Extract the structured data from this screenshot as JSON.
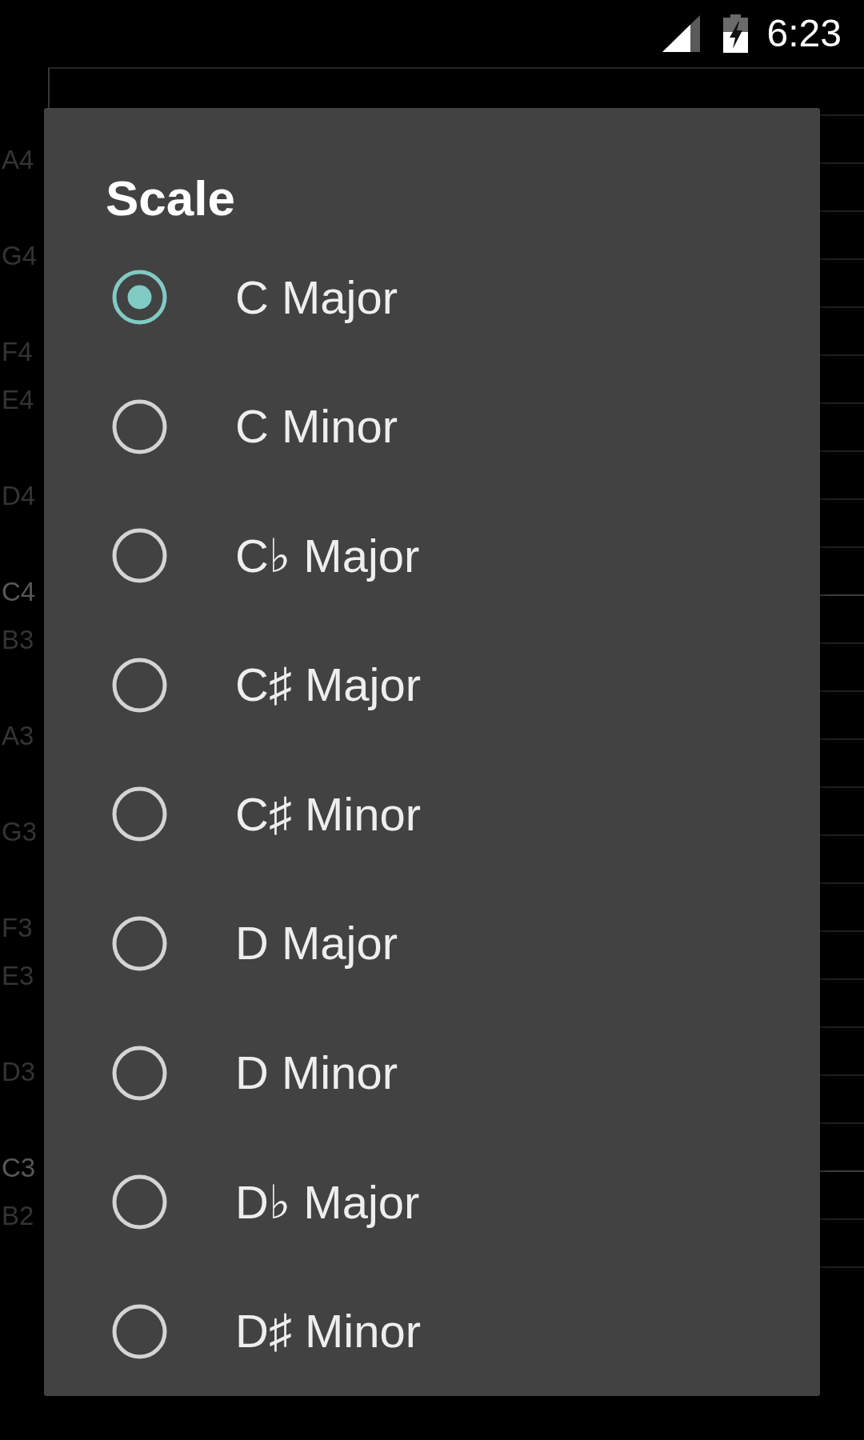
{
  "status_bar": {
    "time": "6:23"
  },
  "piano_roll": {
    "rows": [
      {
        "kind": "sharp"
      },
      {
        "kind": "natural",
        "label": "A4"
      },
      {
        "kind": "sharp"
      },
      {
        "kind": "natural",
        "label": "G4"
      },
      {
        "kind": "sharp"
      },
      {
        "kind": "natural",
        "label": "F4"
      },
      {
        "kind": "natural",
        "label": "E4"
      },
      {
        "kind": "sharp"
      },
      {
        "kind": "natural",
        "label": "D4"
      },
      {
        "kind": "sharp"
      },
      {
        "kind": "octave",
        "label": "C4"
      },
      {
        "kind": "natural",
        "label": "B3"
      },
      {
        "kind": "sharp"
      },
      {
        "kind": "natural",
        "label": "A3"
      },
      {
        "kind": "sharp"
      },
      {
        "kind": "natural",
        "label": "G3"
      },
      {
        "kind": "sharp"
      },
      {
        "kind": "natural",
        "label": "F3"
      },
      {
        "kind": "natural",
        "label": "E3"
      },
      {
        "kind": "sharp"
      },
      {
        "kind": "natural",
        "label": "D3"
      },
      {
        "kind": "sharp"
      },
      {
        "kind": "octave",
        "label": "C3"
      },
      {
        "kind": "natural",
        "label": "B2"
      },
      {
        "kind": "sharp"
      }
    ]
  },
  "dialog": {
    "title": "Scale",
    "options": [
      {
        "label": "C Major",
        "selected": true
      },
      {
        "label": "C Minor",
        "selected": false
      },
      {
        "label": "C♭ Major",
        "selected": false
      },
      {
        "label": "C♯ Major",
        "selected": false
      },
      {
        "label": "C♯ Minor",
        "selected": false
      },
      {
        "label": "D Major",
        "selected": false
      },
      {
        "label": "D Minor",
        "selected": false
      },
      {
        "label": "D♭ Major",
        "selected": false
      },
      {
        "label": "D♯ Minor",
        "selected": false
      }
    ]
  }
}
